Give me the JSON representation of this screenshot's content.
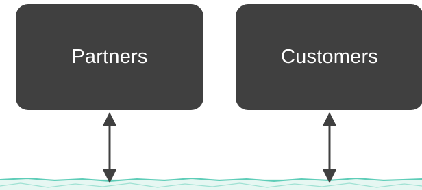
{
  "diagram": {
    "nodes": [
      {
        "id": "partners",
        "label": "Partners"
      },
      {
        "id": "customers",
        "label": "Customers"
      }
    ],
    "colors": {
      "box_fill": "#404040",
      "box_text": "#ffffff",
      "arrow": "#404040",
      "band_line": "#5ecdb8",
      "band_fill": "#e6f7f2"
    },
    "edges": [
      {
        "from": "partners",
        "to": "platform-band",
        "style": "bidirectional"
      },
      {
        "from": "customers",
        "to": "platform-band",
        "style": "bidirectional"
      }
    ]
  }
}
